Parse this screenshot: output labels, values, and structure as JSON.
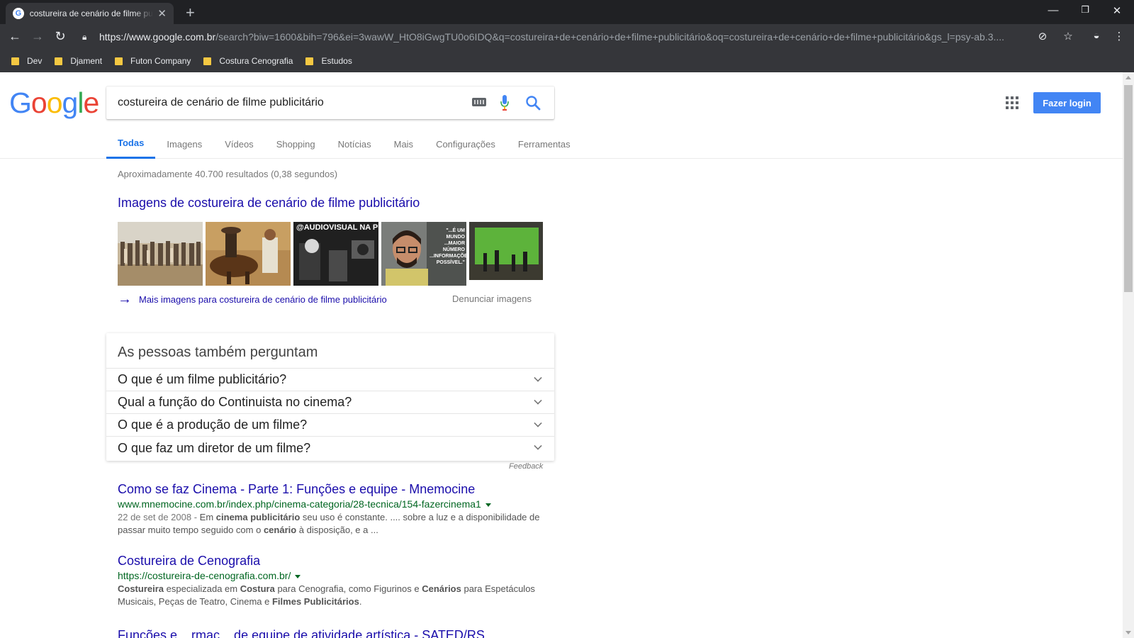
{
  "browser": {
    "tab_title": "costureira de cenário de filme publicitário - Pesquisa Google",
    "new_tab_glyph": "+",
    "url_host": "https://www.google.com.br",
    "url_path": "/search?biw=1600&bih=796&ei=3wawW_HtO8iGwgTU0o6IDQ&q=costureira+de+cenário+de+filme+publicitário&oq=costureira+de+cenário+de+filme+publicitário&gs_l=psy-ab.3....",
    "bookmarks": [
      "Dev",
      "Djament",
      "Futon Company",
      "Costura Cenografia",
      "Estudos"
    ]
  },
  "search": {
    "query": "costureira de cenário de filme publicitário",
    "login_label": "Fazer login",
    "tabs": [
      "Todas",
      "Imagens",
      "Vídeos",
      "Shopping",
      "Notícias",
      "Mais",
      "Configurações",
      "Ferramentas"
    ],
    "stats": "Aproximadamente 40.700 resultados (0,38 segundos)"
  },
  "images_block": {
    "title": "Imagens de costureira de cenário de filme publicitário",
    "more_link": "Mais imagens para costureira de cenário de filme publicitário",
    "report": "Denunciar imagens",
    "thumb3_caption": "@AUDIOVISUAL NA PUBI",
    "thumb4_quote": "\"...É UM MUNDO ...MAIOR NÚMERO ...INFORMAÇÕES POSSÍVEL.\""
  },
  "people_also_ask": {
    "heading": "As pessoas também perguntam",
    "questions": [
      "O que é um filme publicitário?",
      "Qual a função do Continuista no cinema?",
      "O que é a produção de um filme?",
      "O que faz um diretor de um filme?"
    ],
    "feedback": "Feedback"
  },
  "results": [
    {
      "title": "Como se faz Cinema - Parte 1: Funções e equipe - Mnemocine",
      "url": "www.mnemocine.com.br/index.php/cinema-categoria/28-tecnica/154-fazercinema1",
      "date": "22 de set de 2008 - ",
      "snippet_parts": [
        "Em ",
        "cinema publicitário",
        " seu uso é constante. .... sobre a luz e a disponibilidade de passar muito tempo seguido com o ",
        "cenário",
        " à disposição, e a ..."
      ]
    },
    {
      "title": "Costureira de Cenografia",
      "url": "https://costureira-de-cenografia.com.br/",
      "snippet_parts": [
        "Costureira",
        " especializada em ",
        "Costura",
        " para Cenografia, como Figurinos e ",
        "Cenários",
        " para Espetáculos Musicais, Peças de Teatro, Cinema e ",
        "Filmes Publicitários",
        "."
      ]
    },
    {
      "title": "Funções e ...rmaç... de equipe de atividade artística - SATED/RS"
    }
  ]
}
